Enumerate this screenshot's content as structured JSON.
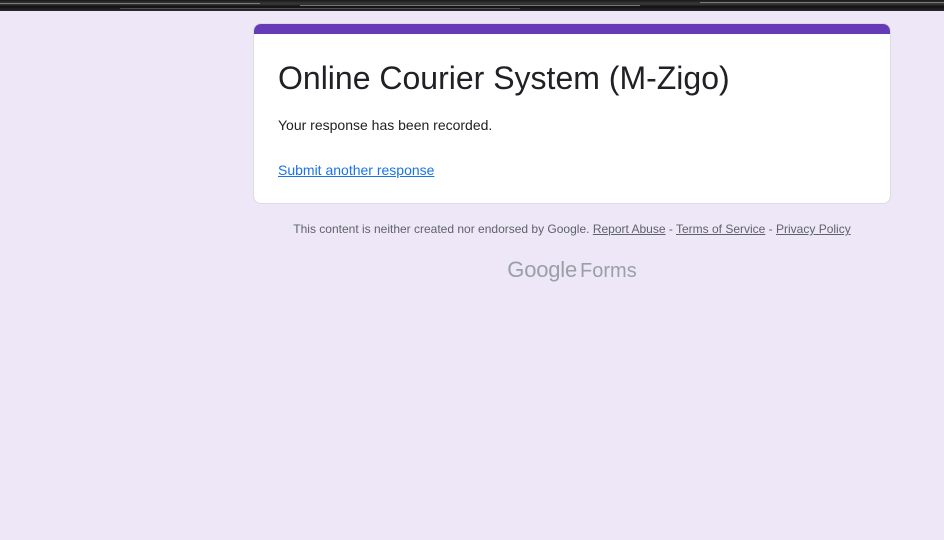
{
  "form": {
    "title": "Online Courier System (M-Zigo)",
    "confirmation_message": "Your response has been recorded.",
    "submit_another_label": "Submit another response",
    "accent_color": "#673ab7"
  },
  "footer": {
    "disclaimer": "This content is neither created nor endorsed by Google.",
    "report_abuse": "Report Abuse",
    "separator": " - ",
    "terms": "Terms of Service",
    "privacy": "Privacy Policy"
  },
  "brand": {
    "google": "Google",
    "product": "Forms"
  },
  "colors": {
    "background": "#ede7f7",
    "link": "#1a73e8",
    "muted_text": "#5f6368"
  }
}
